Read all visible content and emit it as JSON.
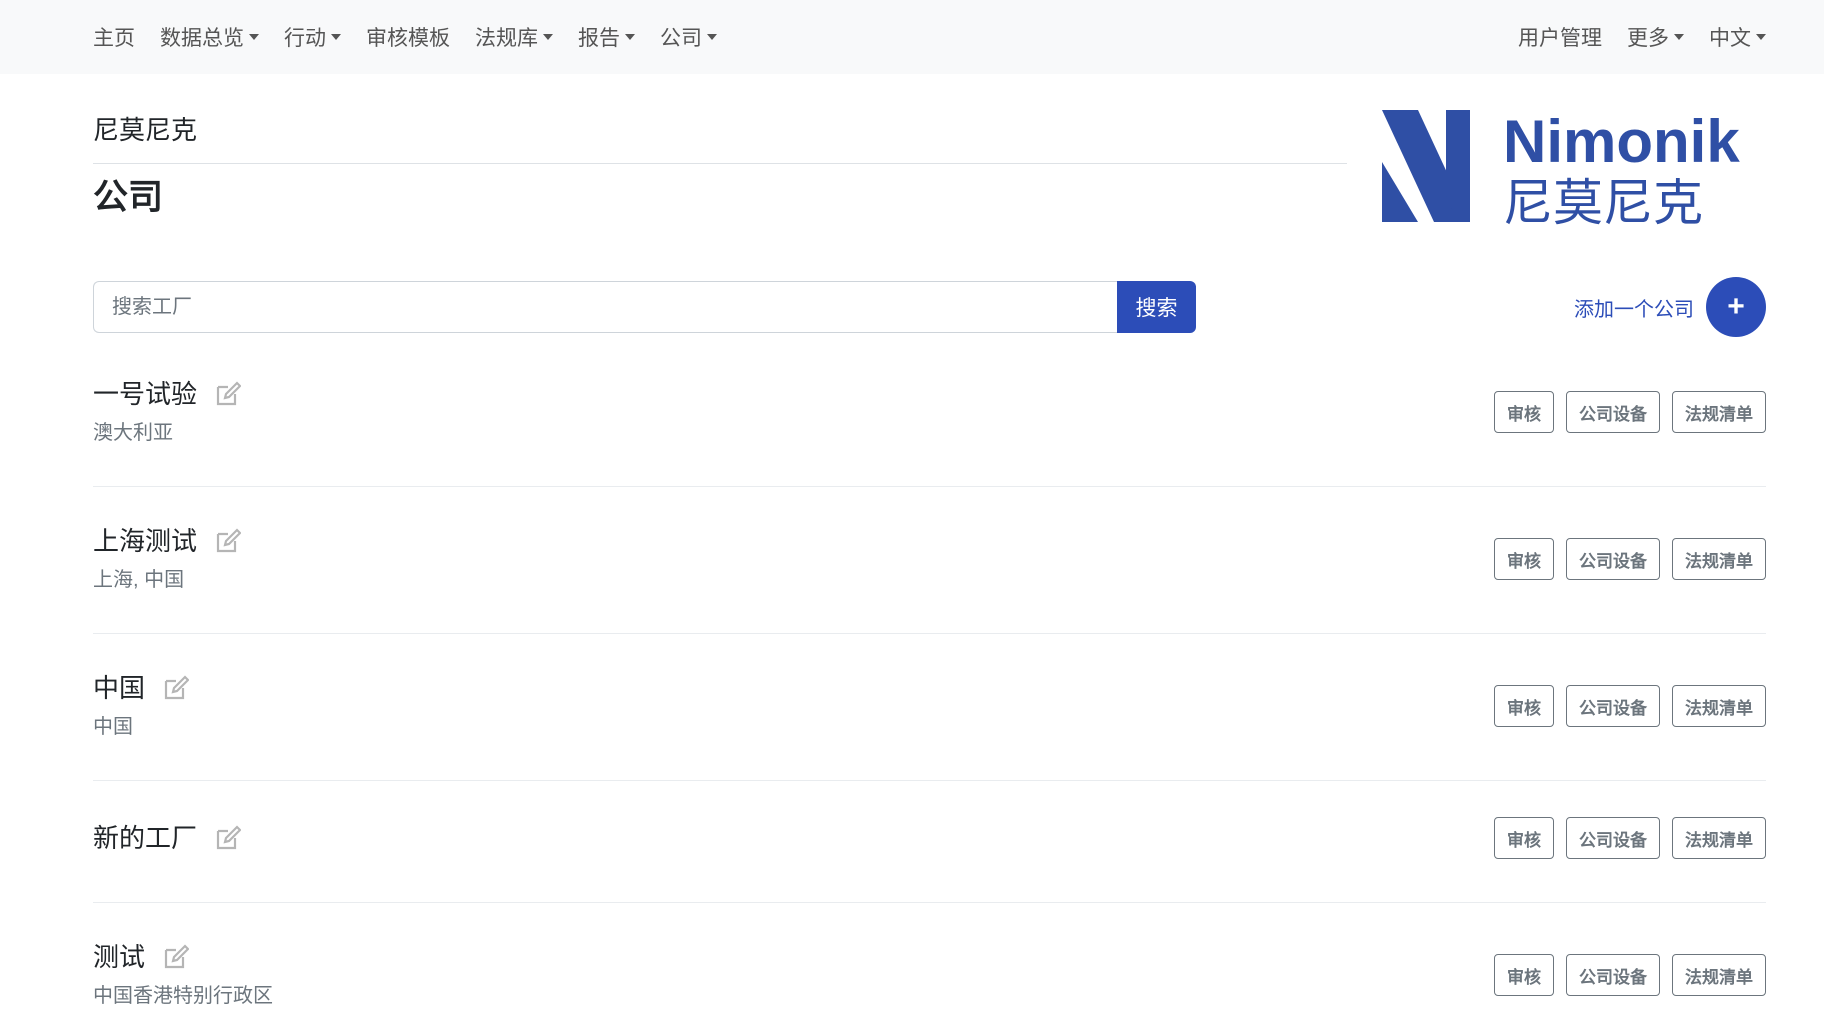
{
  "nav": {
    "left": [
      {
        "label": "主页"
      },
      {
        "label": "数据总览"
      },
      {
        "label": "行动"
      },
      {
        "label": "审核模板"
      },
      {
        "label": "法规库"
      },
      {
        "label": "报告"
      },
      {
        "label": "公司"
      }
    ],
    "right": [
      {
        "label": "用户管理"
      },
      {
        "label": "更多"
      },
      {
        "label": "中文"
      }
    ]
  },
  "header": {
    "breadcrumb": "尼莫尼克",
    "title": "公司"
  },
  "logo": {
    "wordmark": "Nimonik",
    "wordmark_cn": "尼莫尼克",
    "color": "#2f4fa5"
  },
  "search": {
    "placeholder": "搜索工厂",
    "value": "",
    "button_label": "搜索"
  },
  "add_company": {
    "label": "添加一个公司",
    "icon": "+"
  },
  "row_actions": {
    "audit": "审核",
    "equipment": "公司设备",
    "regulations": "法规清单"
  },
  "companies": [
    {
      "name": "一号试验",
      "location": "澳大利亚"
    },
    {
      "name": "上海测试",
      "location": "上海, 中国"
    },
    {
      "name": "中国",
      "location": "中国"
    },
    {
      "name": "新的工厂",
      "location": ""
    },
    {
      "name": "测试",
      "location": "中国香港特别行政区"
    }
  ],
  "colors": {
    "primary": "#2c4db8",
    "navbar_bg": "#f8f9fa",
    "muted_text": "#6c757d"
  }
}
